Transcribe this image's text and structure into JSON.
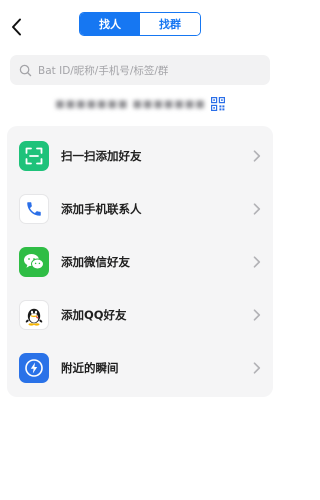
{
  "header": {
    "tabs": [
      {
        "label": "找人",
        "active": true
      },
      {
        "label": "找群",
        "active": false
      }
    ]
  },
  "search": {
    "placeholder": "Bat ID/昵称/手机号/标签/群"
  },
  "my_id": {
    "text": "■■■■■■■ ■■■■■■■"
  },
  "menu": {
    "items": [
      {
        "label": "扫一扫添加好友",
        "icon": "scan-icon",
        "color": "#1ec27a"
      },
      {
        "label": "添加手机联系人",
        "icon": "phone-icon",
        "color": "#2b6fe8"
      },
      {
        "label": "添加微信好友",
        "icon": "wechat-icon",
        "color": "#2fbd45"
      },
      {
        "label": "添加QQ好友",
        "icon": "qq-icon",
        "color": "#000000"
      },
      {
        "label": "附近的瞬间",
        "icon": "lightning-icon",
        "color": "#2a72e8"
      }
    ]
  },
  "colors": {
    "accent": "#1677f2",
    "card_bg": "#f5f5f6",
    "search_bg": "#f2f2f3"
  }
}
